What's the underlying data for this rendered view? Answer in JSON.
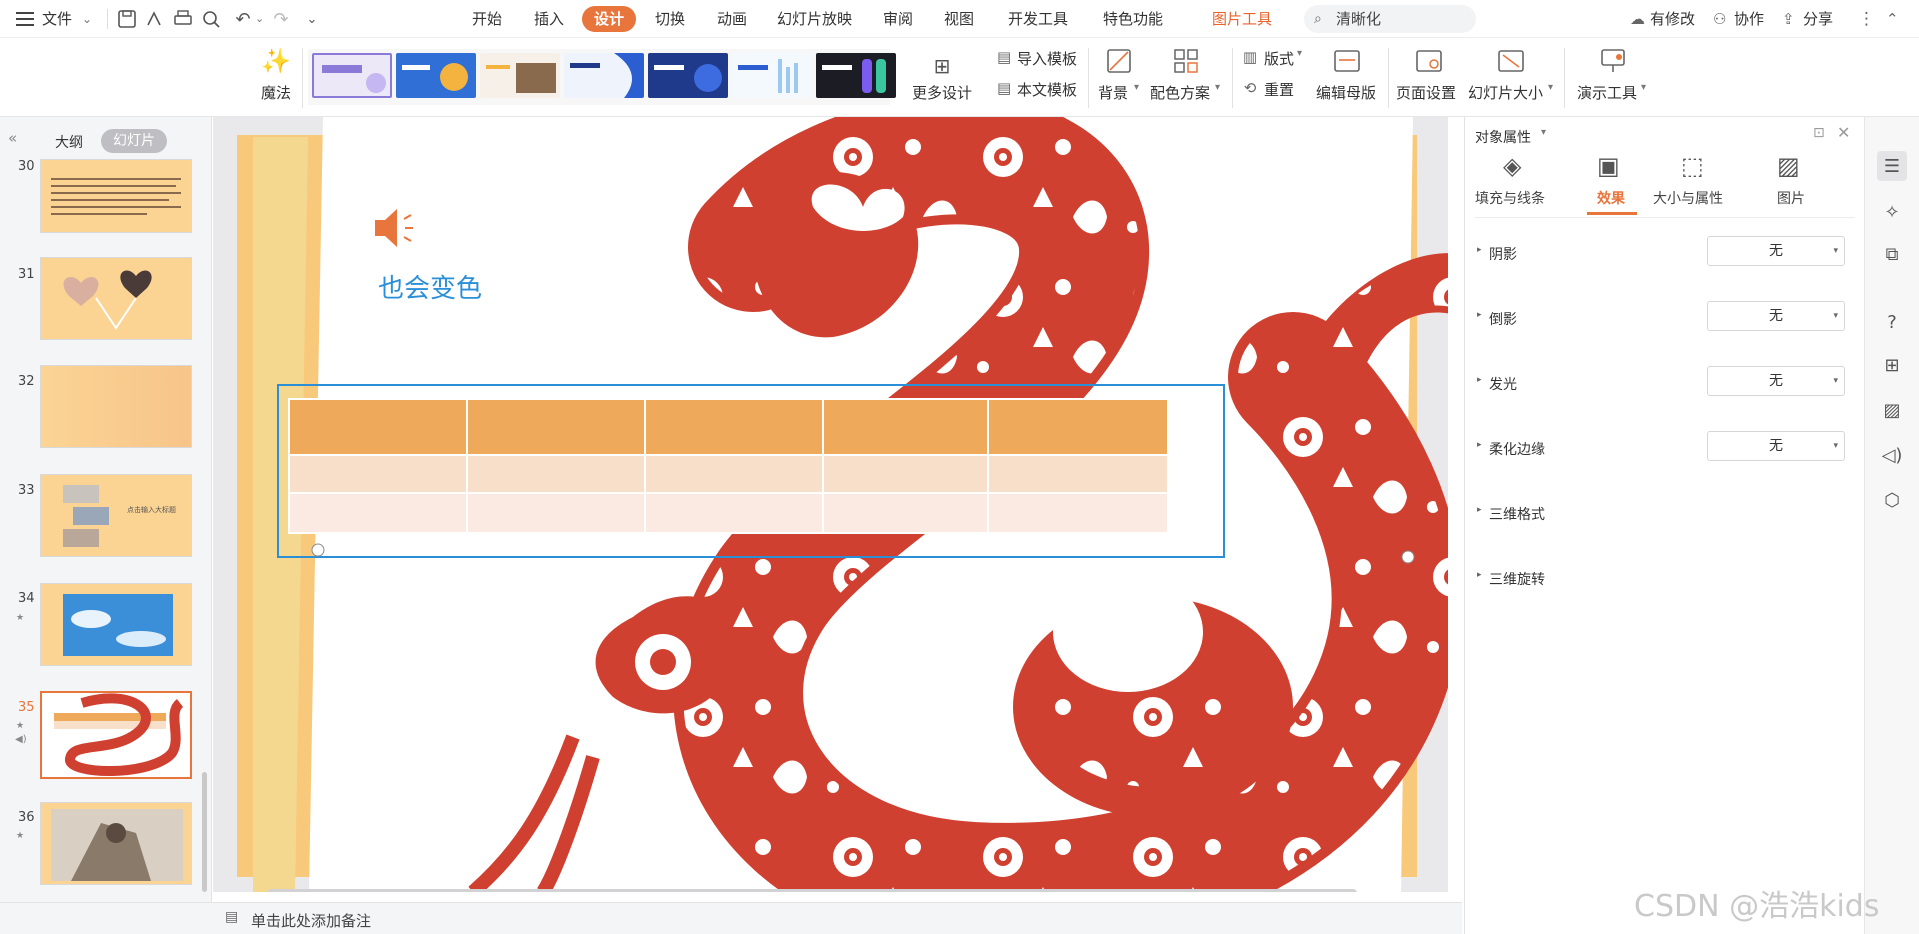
{
  "menubar": {
    "file": "文件",
    "tabs": [
      "开始",
      "插入",
      "设计",
      "切换",
      "动画",
      "幻灯片放映",
      "审阅",
      "视图",
      "开发工具",
      "特色功能"
    ],
    "context_tab": "图片工具",
    "search_text": "清晰化",
    "has_changes": "有修改",
    "collaborate": "协作",
    "share": "分享"
  },
  "ribbon": {
    "magic": "魔法",
    "more_design": "更多设计",
    "import_template": "导入模板",
    "body_template": "本文模板",
    "background": "背景",
    "color_scheme": "配色方案",
    "layout": "版式",
    "reset": "重置",
    "edit_master": "编辑母版",
    "page_setup": "页面设置",
    "slide_size": "幻灯片大小",
    "present_tools": "演示工具",
    "theme_thumb_colors": [
      "#8c7ad9",
      "#2f6fd6",
      "#f3b33e",
      "#2b5fd1",
      "#1f3a8a",
      "#9ec8ef",
      "#1c1c24"
    ]
  },
  "left_pane": {
    "outline_tab": "大纲",
    "slides_tab": "幻灯片",
    "slides": [
      {
        "number": "30",
        "kind": "text"
      },
      {
        "number": "31",
        "kind": "hearts"
      },
      {
        "number": "32",
        "kind": "blank"
      },
      {
        "number": "33",
        "kind": "photos",
        "caption": "点击输入大标题"
      },
      {
        "number": "34",
        "kind": "sky",
        "star": "★"
      },
      {
        "number": "35",
        "kind": "snake",
        "star": "★",
        "selected": true
      },
      {
        "number": "36",
        "kind": "portrait",
        "star": "★"
      }
    ],
    "add_label": "+"
  },
  "slide": {
    "title": "也会变色",
    "bg_color": "#f8c97a",
    "snake_color": "#d04030",
    "table": {
      "header_color": "#eea95a",
      "row_colors": [
        "#f8dfc9",
        "#faeae1"
      ],
      "columns": 5,
      "rows": 3
    }
  },
  "status": {
    "notes_placeholder": "单击此处添加备注"
  },
  "right_panel": {
    "title": "对象属性",
    "tabs": [
      "填充与线条",
      "效果",
      "大小与属性",
      "图片"
    ],
    "active_tab": "效果",
    "properties": [
      {
        "label": "阴影",
        "value": "无"
      },
      {
        "label": "倒影",
        "value": "无"
      },
      {
        "label": "发光",
        "value": "无"
      },
      {
        "label": "柔化边缘",
        "value": "无"
      },
      {
        "label": "三维格式",
        "value": ""
      },
      {
        "label": "三维旋转",
        "value": ""
      }
    ]
  },
  "watermark": "CSDN @浩浩kids"
}
